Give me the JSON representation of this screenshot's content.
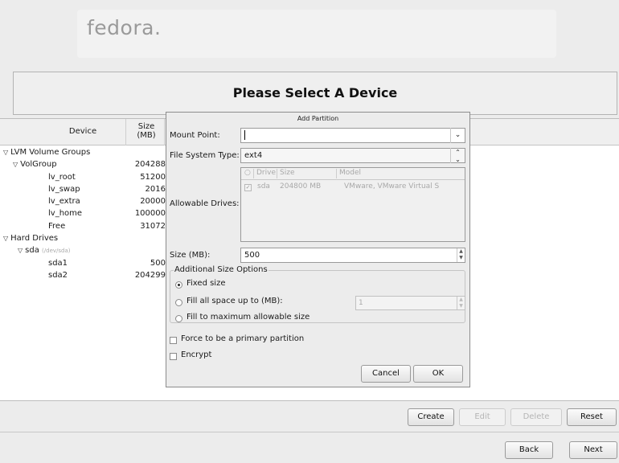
{
  "brand": {
    "logo_text": "fedora."
  },
  "page": {
    "title": "Please Select A Device"
  },
  "tree": {
    "headers": {
      "device": "Device",
      "size": "Size\n(MB)"
    },
    "rows": [
      {
        "name": "LVM Volume Groups",
        "size": "",
        "level": 0,
        "expander": "▽"
      },
      {
        "name": "VolGroup",
        "size": "204288",
        "level": 1,
        "expander": "▽"
      },
      {
        "name": "lv_root",
        "size": "51200",
        "level": 2,
        "expander": ""
      },
      {
        "name": "lv_swap",
        "size": "2016",
        "level": 2,
        "expander": ""
      },
      {
        "name": "lv_extra",
        "size": "20000",
        "level": 2,
        "expander": ""
      },
      {
        "name": "lv_home",
        "size": "100000",
        "level": 2,
        "expander": ""
      },
      {
        "name": "Free",
        "size": "31072",
        "level": 2,
        "expander": ""
      },
      {
        "name": "Hard Drives",
        "size": "",
        "level": 0,
        "expander": "▽"
      },
      {
        "name": "sda",
        "path": "(/dev/sda)",
        "size": "",
        "level": 1,
        "expander": "▽"
      },
      {
        "name": "sda1",
        "size": "500",
        "level": 2,
        "expander": ""
      },
      {
        "name": "sda2",
        "size": "204299",
        "level": 2,
        "expander": ""
      }
    ]
  },
  "dialog": {
    "title": "Add Partition",
    "mount_point_label": "Mount Point:",
    "mount_point_value": "",
    "fs_type_label": "File System Type:",
    "fs_type_value": "ext4",
    "allowable_drives_label": "Allowable Drives:",
    "drives_columns": {
      "radio": "○",
      "drive": "Drive",
      "size": "Size",
      "model": "Model"
    },
    "drives": [
      {
        "checked": true,
        "drive": "sda",
        "size": "204800 MB",
        "model": "VMware, VMware Virtual S"
      }
    ],
    "size_label": "Size (MB):",
    "size_value": "500",
    "additional_options_label": "Additional Size Options",
    "options": {
      "fixed": "Fixed size",
      "fill_up_to": "Fill all space up to (MB):",
      "fill_max": "Fill to maximum allowable size",
      "fill_up_to_value": "1",
      "selected": "fixed"
    },
    "force_primary_label": "Force to be a primary partition",
    "encrypt_label": "Encrypt",
    "cancel_label": "Cancel",
    "ok_label": "OK"
  },
  "actions": {
    "create": "Create",
    "edit": "Edit",
    "delete": "Delete",
    "reset": "Reset"
  },
  "nav": {
    "back": "Back",
    "next": "Next"
  },
  "icons": {
    "expand": "triangle-down-icon",
    "dropdown": "chevron-down-icon",
    "spinner": "spinner-arrows-icon",
    "checkbox": "checkbox-icon",
    "radio": "radio-icon"
  }
}
